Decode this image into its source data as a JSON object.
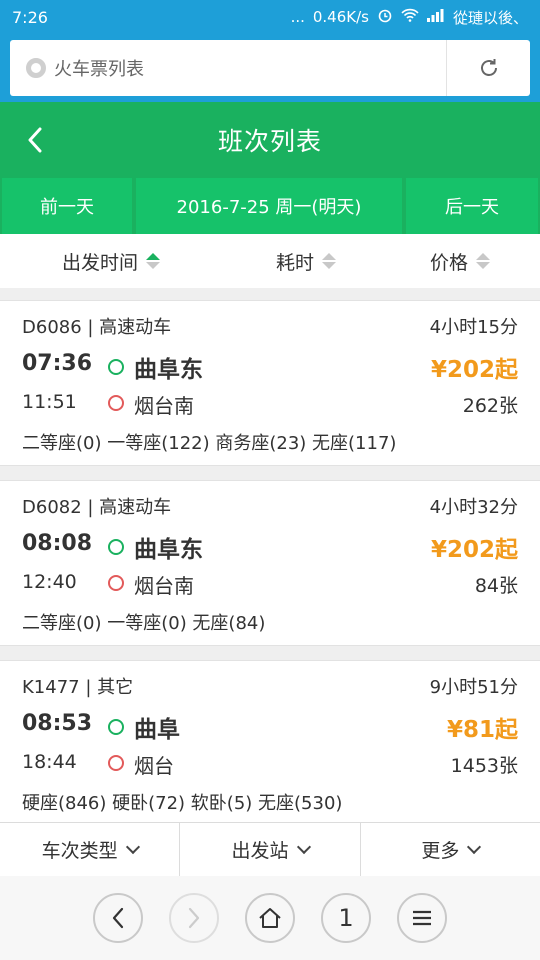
{
  "status_bar": {
    "time": "7:26",
    "dots": "...",
    "network_speed": "0.46K/s",
    "carrier": "從璉以後、"
  },
  "browser": {
    "url_title": "火车票列表",
    "icons": {
      "site": "site-loading-icon",
      "refresh": "refresh-icon"
    }
  },
  "header": {
    "title": "班次列表",
    "back_icon": "back-chevron-icon"
  },
  "date_nav": {
    "prev": "前一天",
    "current": "2016-7-25 周一(明天)",
    "next": "后一天"
  },
  "sort": {
    "departure": "出发时间",
    "duration": "耗时",
    "price": "价格"
  },
  "trains": [
    {
      "number_type": "D6086 | 高速动车",
      "duration": "4小时15分",
      "dep_time": "07:36",
      "dep_station": "曲阜东",
      "arr_time": "11:51",
      "arr_station": "烟台南",
      "price": "¥202起",
      "tickets": "262张",
      "seats": "二等座(0) 一等座(122) 商务座(23) 无座(117)"
    },
    {
      "number_type": "D6082 | 高速动车",
      "duration": "4小时32分",
      "dep_time": "08:08",
      "dep_station": "曲阜东",
      "arr_time": "12:40",
      "arr_station": "烟台南",
      "price": "¥202起",
      "tickets": "84张",
      "seats": "二等座(0) 一等座(0) 无座(84)"
    },
    {
      "number_type": "K1477 | 其它",
      "duration": "9小时51分",
      "dep_time": "08:53",
      "dep_station": "曲阜",
      "arr_time": "18:44",
      "arr_station": "烟台",
      "price": "¥81起",
      "tickets": "1453张",
      "seats": "硬座(846) 硬卧(72) 软卧(5) 无座(530)"
    }
  ],
  "filters": {
    "train_type": "车次类型",
    "station": "出发站",
    "more": "更多"
  },
  "bottom_nav": {
    "tab_count": "1"
  },
  "colors": {
    "status_blue": "#1e9fd8",
    "header_green": "#1ab15f",
    "price_orange": "#f29a1c",
    "arrival_red": "#e25a5a"
  }
}
